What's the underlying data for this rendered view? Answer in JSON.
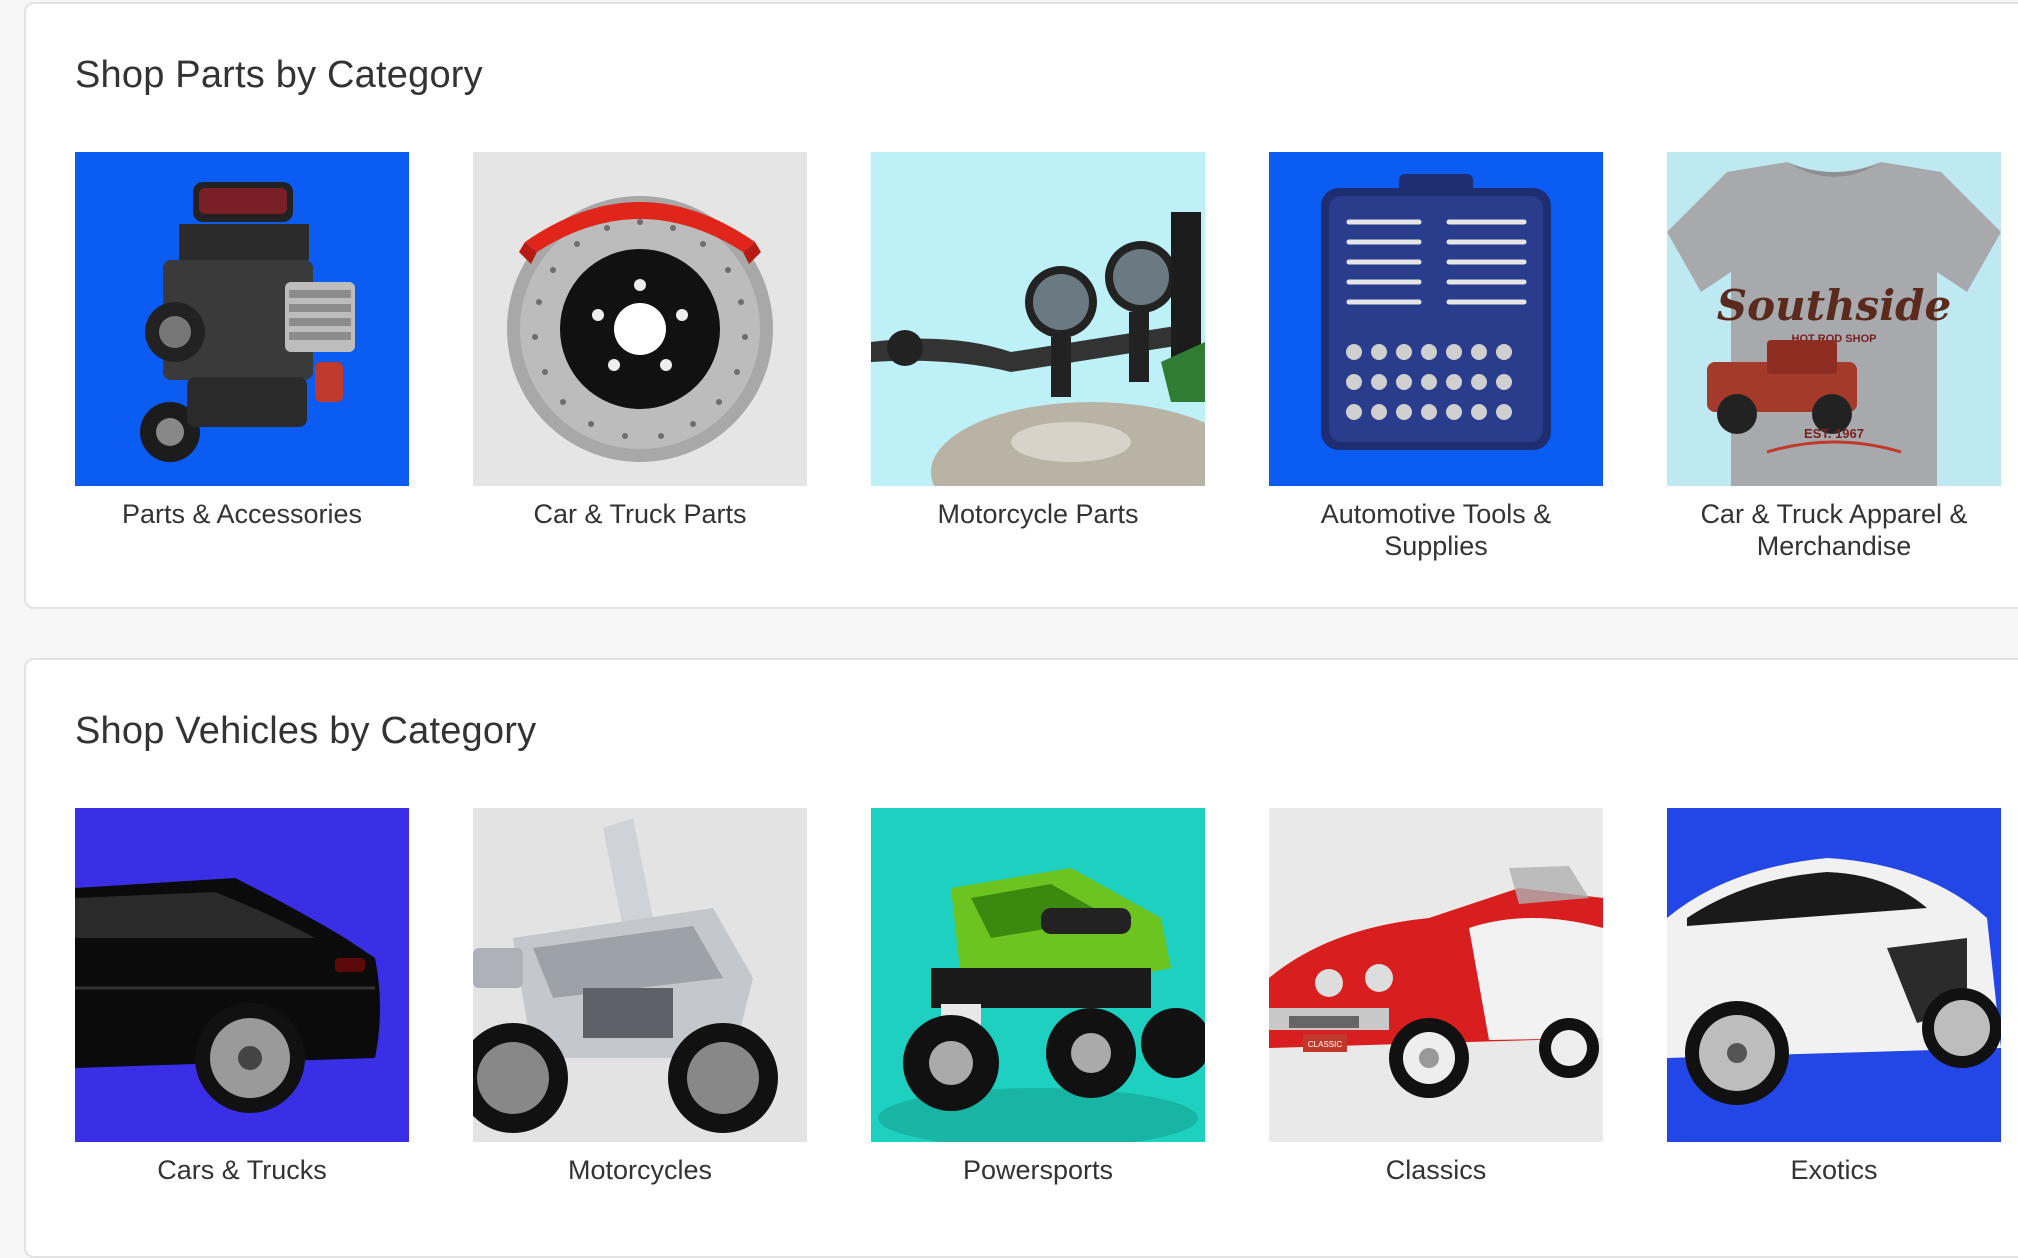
{
  "parts_section": {
    "title": "Shop Parts by Category",
    "items": [
      {
        "label": "Parts & Accessories",
        "bg": "#0b5cf2",
        "icon": "engine-icon"
      },
      {
        "label": "Car & Truck Parts",
        "bg": "#e5e5e5",
        "icon": "brake-disc-icon"
      },
      {
        "label": "Motorcycle Parts",
        "bg": "#bdf0f7",
        "icon": "motorcycle-gauges-icon"
      },
      {
        "label": "Automotive Tools & Supplies",
        "bg": "#0b5cf2",
        "icon": "toolbox-icon"
      },
      {
        "label": "Car & Truck Apparel & Merchandise",
        "bg": "#bfe9f1",
        "icon": "tshirt-icon"
      }
    ]
  },
  "vehicles_section": {
    "title": "Shop Vehicles by Category",
    "items": [
      {
        "label": "Cars & Trucks",
        "bg": "#3a2fe6",
        "icon": "sedan-icon"
      },
      {
        "label": "Motorcycles",
        "bg": "#e3e3e3",
        "icon": "motorcycle-icon"
      },
      {
        "label": "Powersports",
        "bg": "#1dd0bf",
        "icon": "atv-icon"
      },
      {
        "label": "Classics",
        "bg": "#e9e9e9",
        "icon": "classic-car-icon"
      },
      {
        "label": "Exotics",
        "bg": "#2346e6",
        "icon": "sports-car-icon"
      }
    ]
  },
  "tshirt_print": {
    "line1": "Southside",
    "line2": "HOT ROD SHOP",
    "line3": "EST. 1967"
  },
  "plate_text": "CLASSIC"
}
